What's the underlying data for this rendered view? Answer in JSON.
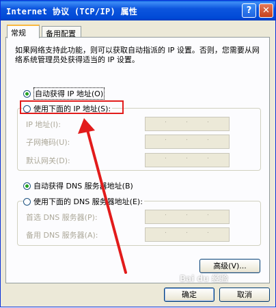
{
  "window": {
    "title": "Internet 协议 (TCP/IP) 属性",
    "help_button": "?",
    "close_button": "✕"
  },
  "tabs": [
    {
      "label": "常规",
      "active": true
    },
    {
      "label": "备用配置",
      "active": false
    }
  ],
  "description": "如果网络支持此功能，则可以获取自动指派的 IP 设置。否则，您需要从网络系统管理员处获得适当的 IP 设置。",
  "ip_section": {
    "auto_option": "自动获得 IP 地址(O)",
    "manual_option": "使用下面的 IP 地址(S):",
    "fields": [
      {
        "label": "IP 地址(I):"
      },
      {
        "label": "子网掩码(U):"
      },
      {
        "label": "默认网关(D):"
      }
    ]
  },
  "dns_section": {
    "auto_option": "自动获得 DNS 服务器地址(B)",
    "manual_option": "使用下面的 DNS 服务器地址(E):",
    "fields": [
      {
        "label": "首选 DNS 服务器(P):"
      },
      {
        "label": "备用 DNS 服务器(A):"
      }
    ]
  },
  "buttons": {
    "advanced": "高级(V)...",
    "ok": "确定",
    "cancel": "取消"
  },
  "watermark": "Bai du 经验",
  "colors": {
    "titlebar": "#0049d6",
    "dialog_bg": "#ece9d8",
    "highlight": "#e21b1b"
  }
}
